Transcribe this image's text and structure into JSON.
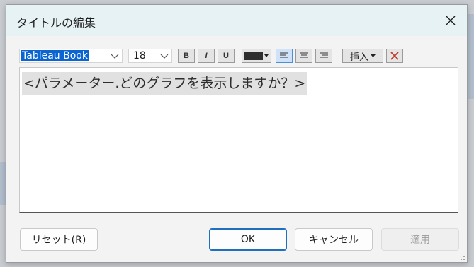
{
  "dialog": {
    "title": "タイトルの編集"
  },
  "toolbar": {
    "font_family": "Tableau Book",
    "font_size": "18",
    "bold_label": "B",
    "italic_label": "I",
    "underline_label": "U",
    "text_color": "#2e2e2e",
    "alignment": "left",
    "insert_label": "挿入",
    "icons": {
      "dropdown": "chevron-down-icon",
      "align_left": "align-left-icon",
      "align_center": "align-center-icon",
      "align_right": "align-right-icon",
      "clear": "clear-x-icon",
      "close": "close-icon"
    }
  },
  "editor": {
    "text": "<パラメーター.どのグラフを表示しますか？>"
  },
  "buttons": {
    "reset": "リセット(R)",
    "ok": "OK",
    "cancel": "キャンセル",
    "apply": "適用"
  },
  "colors": {
    "selection": "#0a64d2",
    "title_bar": "#e7f2f5",
    "primary_border": "#1f6fbf",
    "clear_icon": "#c0392b"
  }
}
